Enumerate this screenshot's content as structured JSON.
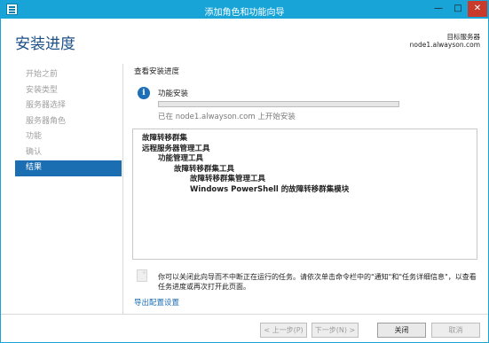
{
  "window": {
    "title": "添加角色和功能向导",
    "controls": {
      "minimize": "—",
      "maximize": "□",
      "close": "✕"
    },
    "icon": "server-manager-icon"
  },
  "header": {
    "heading": "安装进度",
    "target_label": "目标服务器",
    "target_server": "node1.alwayson.com"
  },
  "nav": {
    "items": [
      {
        "label": "开始之前",
        "state": "disabled"
      },
      {
        "label": "安装类型",
        "state": "disabled"
      },
      {
        "label": "服务器选择",
        "state": "disabled"
      },
      {
        "label": "服务器角色",
        "state": "disabled"
      },
      {
        "label": "功能",
        "state": "disabled"
      },
      {
        "label": "确认",
        "state": "disabled"
      },
      {
        "label": "结果",
        "state": "active"
      }
    ]
  },
  "main": {
    "section_title": "查看安装进度",
    "status_title": "功能安装",
    "progress_fraction": 0.0,
    "progress_text": "已在 node1.alwayson.com 上开始安装",
    "results": [
      {
        "text": "故障转移群集",
        "level": 0
      },
      {
        "text": "远程服务器管理工具",
        "level": 0
      },
      {
        "text": "功能管理工具",
        "level": 1
      },
      {
        "text": "故障转移群集工具",
        "level": 2
      },
      {
        "text": "故障转移群集管理工具",
        "level": 3
      },
      {
        "text": "Windows PowerShell 的故障转移群集模块",
        "level": 3
      }
    ],
    "note": "你可以关闭此向导而不中断正在运行的任务。请依次单击命令栏中的\"通知\"和\"任务详细信息\"，以查看任务进度或再次打开此页面。",
    "export_link": "导出配置设置"
  },
  "footer": {
    "prev": "< 上一步(P)",
    "next": "下一步(N) >",
    "close": "关闭",
    "cancel": "取消"
  },
  "colors": {
    "titlebar": "#19a4d7",
    "heading": "#1b4f86",
    "active_nav": "#1c6eb3",
    "progress": "#1d6fb8",
    "link": "#1c6eb3"
  }
}
